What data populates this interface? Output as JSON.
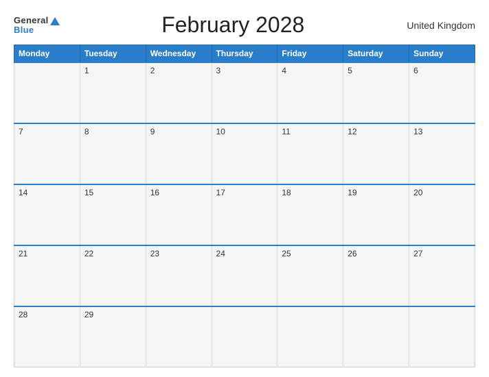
{
  "header": {
    "logo_general": "General",
    "logo_blue": "Blue",
    "title": "February 2028",
    "country": "United Kingdom"
  },
  "days_of_week": [
    "Monday",
    "Tuesday",
    "Wednesday",
    "Thursday",
    "Friday",
    "Saturday",
    "Sunday"
  ],
  "weeks": [
    [
      {
        "num": "",
        "empty": true
      },
      {
        "num": "1",
        "empty": false
      },
      {
        "num": "2",
        "empty": false
      },
      {
        "num": "3",
        "empty": false
      },
      {
        "num": "4",
        "empty": false
      },
      {
        "num": "5",
        "empty": false
      },
      {
        "num": "6",
        "empty": false
      }
    ],
    [
      {
        "num": "7",
        "empty": false
      },
      {
        "num": "8",
        "empty": false
      },
      {
        "num": "9",
        "empty": false
      },
      {
        "num": "10",
        "empty": false
      },
      {
        "num": "11",
        "empty": false
      },
      {
        "num": "12",
        "empty": false
      },
      {
        "num": "13",
        "empty": false
      }
    ],
    [
      {
        "num": "14",
        "empty": false
      },
      {
        "num": "15",
        "empty": false
      },
      {
        "num": "16",
        "empty": false
      },
      {
        "num": "17",
        "empty": false
      },
      {
        "num": "18",
        "empty": false
      },
      {
        "num": "19",
        "empty": false
      },
      {
        "num": "20",
        "empty": false
      }
    ],
    [
      {
        "num": "21",
        "empty": false
      },
      {
        "num": "22",
        "empty": false
      },
      {
        "num": "23",
        "empty": false
      },
      {
        "num": "24",
        "empty": false
      },
      {
        "num": "25",
        "empty": false
      },
      {
        "num": "26",
        "empty": false
      },
      {
        "num": "27",
        "empty": false
      }
    ],
    [
      {
        "num": "28",
        "empty": false
      },
      {
        "num": "29",
        "empty": false
      },
      {
        "num": "",
        "empty": true
      },
      {
        "num": "",
        "empty": true
      },
      {
        "num": "",
        "empty": true
      },
      {
        "num": "",
        "empty": true
      },
      {
        "num": "",
        "empty": true
      }
    ]
  ],
  "colors": {
    "header_bg": "#2a7dc9",
    "row_bg": "#f5f5f5",
    "border_top": "#2a7dc9"
  }
}
